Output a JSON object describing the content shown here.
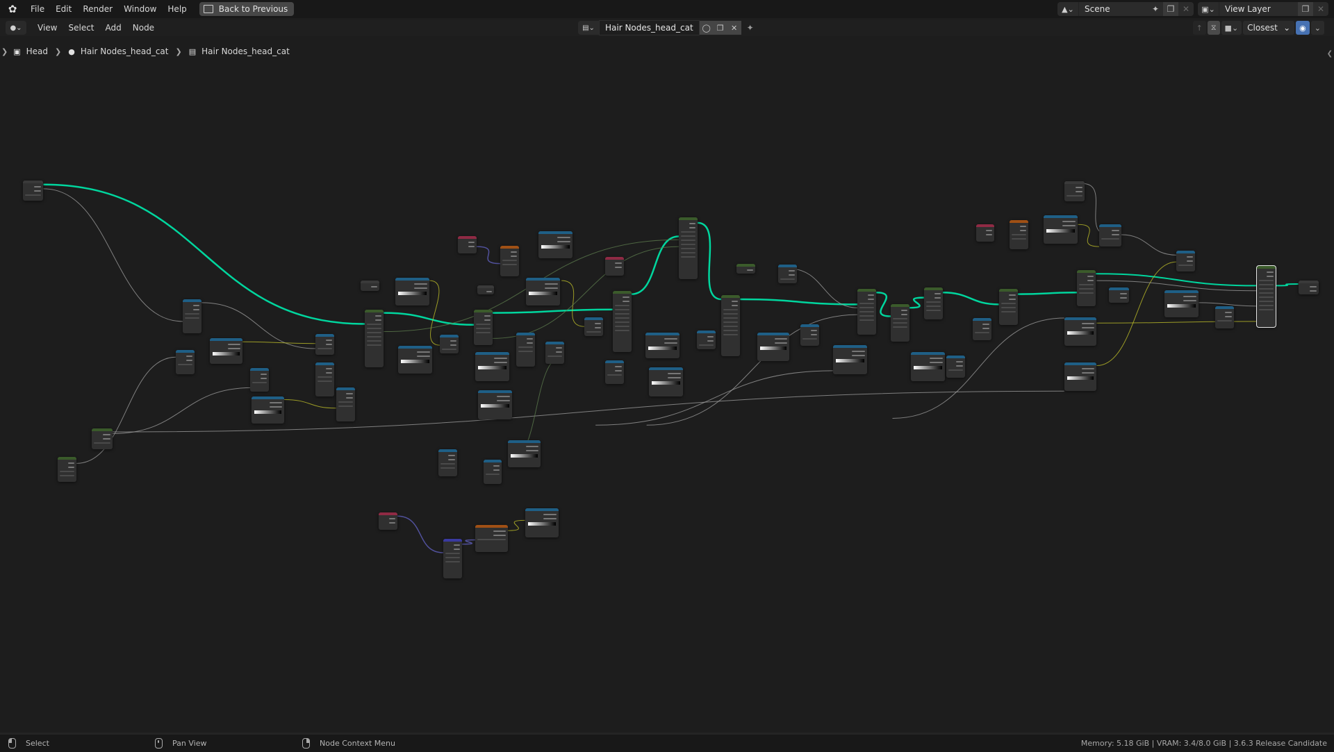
{
  "app": {
    "menu": [
      "File",
      "Edit",
      "Render",
      "Window",
      "Help"
    ],
    "back_button": "Back to Previous"
  },
  "scene": {
    "label": "Scene",
    "icon": "scene-icon"
  },
  "view_layer": {
    "label": "View Layer",
    "icon": "view-layer-icon"
  },
  "editor_header": {
    "menus": [
      "View",
      "Select",
      "Add",
      "Node"
    ],
    "node_tree_name": "Hair Nodes_head_cat",
    "snap_mode": "Closest"
  },
  "breadcrumb": [
    "Head",
    "Hair Nodes_head_cat",
    "Hair Nodes_head_cat"
  ],
  "statusbar": {
    "left_mouse": "Select",
    "middle_mouse": "Pan View",
    "right_mouse": "Node Context Menu",
    "stats": "Memory: 5.18 GiB | VRAM: 3.4/8.0 GiB | 3.6.3 Release Candidate"
  },
  "colors": {
    "geometry_link": "#00d69e",
    "float_link": "#a1a1a1",
    "vector_link": "#6363c7",
    "color_link": "#c7c729",
    "field_link": "#5f7f4f",
    "header_input": "#8f2a44",
    "header_converter": "#1f5f86",
    "header_geometry": "#3a5a2a",
    "header_texture": "#a05015",
    "header_vector": "#3a3aa0",
    "header_group": "#3b5b2b",
    "header_output": "#3a3a3a"
  },
  "graph": {
    "node_count": 74
  }
}
